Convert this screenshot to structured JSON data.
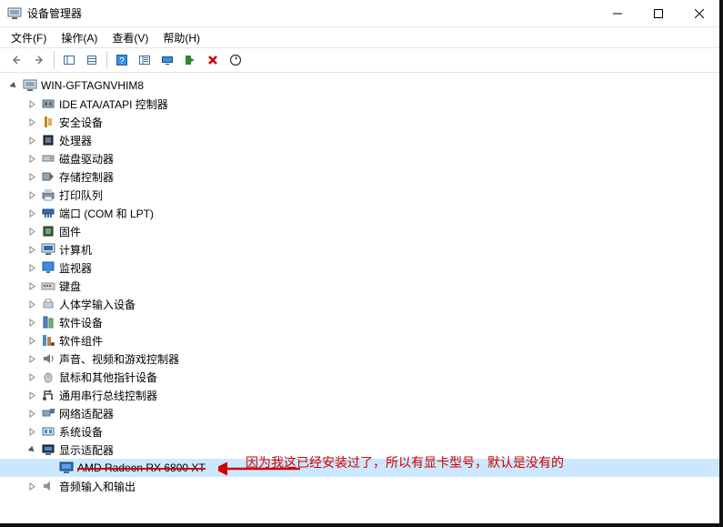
{
  "window": {
    "title": "设备管理器"
  },
  "menubar": {
    "file": "文件(F)",
    "action": "操作(A)",
    "view": "查看(V)",
    "help": "帮助(H)"
  },
  "tree": {
    "root": "WIN-GFTAGNVHIM8",
    "items": [
      {
        "label": "IDE ATA/ATAPI 控制器"
      },
      {
        "label": "安全设备"
      },
      {
        "label": "处理器"
      },
      {
        "label": "磁盘驱动器"
      },
      {
        "label": "存储控制器"
      },
      {
        "label": "打印队列"
      },
      {
        "label": "端口 (COM 和 LPT)"
      },
      {
        "label": "固件"
      },
      {
        "label": "计算机"
      },
      {
        "label": "监视器"
      },
      {
        "label": "键盘"
      },
      {
        "label": "人体学输入设备"
      },
      {
        "label": "软件设备"
      },
      {
        "label": "软件组件"
      },
      {
        "label": "声音、视频和游戏控制器"
      },
      {
        "label": "鼠标和其他指针设备"
      },
      {
        "label": "通用串行总线控制器"
      },
      {
        "label": "网络适配器"
      },
      {
        "label": "系统设备"
      },
      {
        "label": "显示适配器"
      },
      {
        "label": "音频输入和输出"
      }
    ],
    "gpu_device": "AMD Radeon RX 6800 XT"
  },
  "annotation": {
    "text": "因为我这已经安装过了，所以有显卡型号，默认是没有的"
  }
}
